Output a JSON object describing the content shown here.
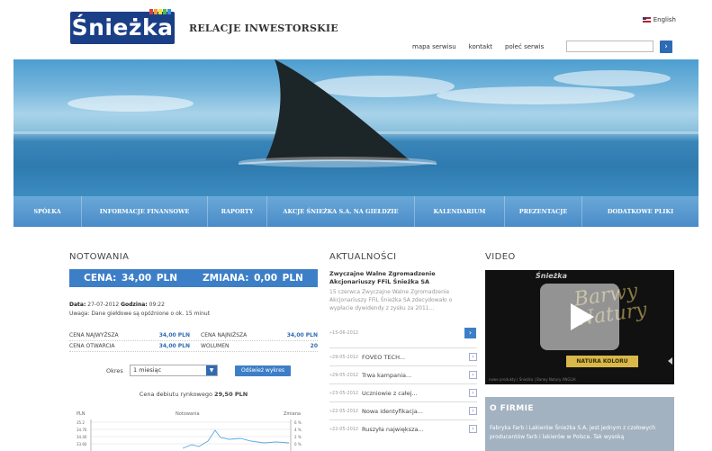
{
  "header": {
    "logo_text": "Śnieżka",
    "tagline": "RELACJE INWESTORSKIE",
    "language": "English",
    "links": [
      "mapa serwisu",
      "kontakt",
      "poleć serwis"
    ],
    "search_placeholder": "",
    "search_button": "›"
  },
  "nav": {
    "items": [
      {
        "label": "SPÓŁKA"
      },
      {
        "label": "INFORMACJE FINANSOWE"
      },
      {
        "label": "RAPORTY"
      },
      {
        "label": "AKCJE ŚNIEŻKA S.A. NA GIEŁDZIE"
      },
      {
        "label": "KALENDARIUM"
      },
      {
        "label": "PREZENTACJE"
      },
      {
        "label": "DODATKOWE PLIKI"
      }
    ]
  },
  "notowania": {
    "title": "NOTOWANIA",
    "price": "CENA: 34,00 PLN",
    "change": "ZMIANA: 0,00 PLN",
    "date_label": "Data:",
    "date_value": "27-07-2012",
    "time_label": "Godzina:",
    "time_value": "09:22",
    "note": "Uwaga: Dane giełdowe są opóźnione o ok. 15 minut",
    "rows": [
      {
        "l1": "CENA NAJWYŻSZA",
        "v1": "34,00 PLN",
        "l2": "CENA NAJNIŻSZA",
        "v2": "34,00 PLN"
      },
      {
        "l1": "CENA OTWARCIA",
        "v1": "34,00 PLN",
        "l2": "WOLUMEN",
        "v2": "20"
      }
    ],
    "period_label": "Okres",
    "period_value": "1 miesiąc",
    "refresh_button": "Odśwież wykres",
    "debut_label": "Cena debiutu rynkowego",
    "debut_value": "29,50 PLN",
    "chart": {
      "left_label": "PLN",
      "title": "Notowania",
      "right_label": "Zmiana",
      "y_ticks": [
        "35.2",
        "34.76",
        "34.40",
        "33.60"
      ],
      "right_ticks": [
        "6 %",
        "4 %",
        "2 %",
        "0 %"
      ]
    }
  },
  "news": {
    "title": "AKTUALNOŚCI",
    "lead_title": "Zwyczajne Walne Zgromadzenie Akcjonariuszy FFiL Śnieżka SA",
    "lead_body": "15 czerwca Zwyczajne Walne Zgromadzenie Akcjonariuszy FFiL Śnieżka SA zdecydowało o wypłacie dywidendy z zysku za 2011...",
    "lead_date": "»15-06-2012",
    "more_button": "›",
    "items": [
      {
        "date": "»29-05-2012",
        "title": "FOVEO TECH..."
      },
      {
        "date": "»29-05-2012",
        "title": "Trwa kampania..."
      },
      {
        "date": "»23-05-2012",
        "title": "Uczniowie z całej..."
      },
      {
        "date": "»22-05-2012",
        "title": "Nowa identyfikacja..."
      },
      {
        "date": "»22-05-2012",
        "title": "Ruszyła największa..."
      }
    ]
  },
  "video": {
    "title": "VIDEO",
    "brand": "Śnieżka",
    "script": "Barwy Natury",
    "badge": "NATURA KOLORU",
    "caption": "nowe produkty | Śnieżka | Barwy Natury ANGLIA"
  },
  "about": {
    "title": "O FIRMIE",
    "body": "Fabryka Farb i Lakierów Śnieżka S.A. jest jednym z czołowych producentów farb i lakierów w Polsce. Tak wysoką"
  },
  "colors": {
    "brand": "#1b3f86",
    "accent": "#3d7fc7",
    "nav": "#5a9ad2",
    "about_bg": "#a3b2c0"
  }
}
